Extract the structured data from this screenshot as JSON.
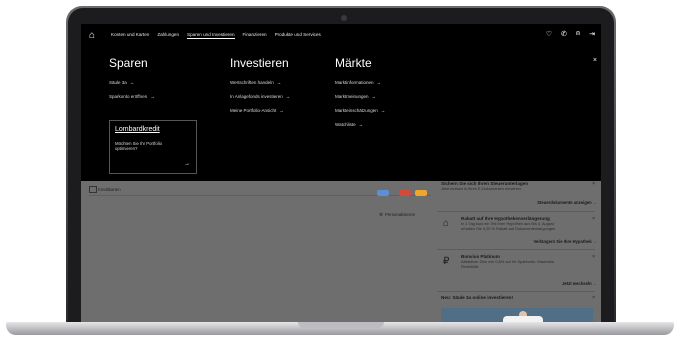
{
  "nav": {
    "home_icon": "home-icon",
    "items": [
      "Konten und Karten",
      "Zahlungen",
      "Sparen und Investieren",
      "Finanzieren",
      "Produkte und Services"
    ],
    "active_index": 2,
    "right_icons": [
      "heart-icon",
      "phone-icon",
      "user-icon",
      "logout-icon"
    ]
  },
  "mega_menu": {
    "columns": [
      {
        "heading": "Sparen",
        "links": [
          "Säule 3a",
          "Sparkonto eröffnen"
        ]
      },
      {
        "heading": "Investieren",
        "links": [
          "Wertschriften handeln",
          "In Anlagefonds investieren",
          "Meine Portfolio-Ansicht"
        ]
      },
      {
        "heading": "Märkte",
        "links": [
          "Marktinformationen",
          "Marktmeinungen",
          "Markteinschätzungen",
          "Watchliste"
        ]
      }
    ],
    "arrow": "→",
    "close": "×",
    "lombard": {
      "title": "Lombardkredit",
      "desc": "Möchten Sie Ihr Portfolio optimieren?",
      "arrow": "→"
    }
  },
  "page": {
    "row_label": "Kreditkarten",
    "personalize": "Personalisieren",
    "sidebar": [
      {
        "title": "Sichern Sie sich Ihren Steuerunterlagen",
        "desc": [
          "Jetzt einfach in Ihren E-Dokumenten einsehen."
        ],
        "cta": "Steuerdokumente anzeigen →",
        "icon": ""
      },
      {
        "title": "Rabatt auf Ihre Hypothekenverlängerung",
        "desc": [
          "In 1 Tag kurz ein Teil Ihrer Hypothek aus Bis 4. August",
          "erhalten Sie 0,20 % Rabatt auf Dokumentenlangungen"
        ],
        "cta": "Verlängern Sie Ihre Hypothek →",
        "icon": "house-percent-icon"
      },
      {
        "title": "Bonvius Platinum",
        "desc": [
          "Attraktiver Zins von 0,6% auf Ihr Sparkonto. Maximale",
          "Flexibilität"
        ],
        "cta": "Jetzt wechseln →",
        "icon": "piggy-bank-icon"
      },
      {
        "title": "Neu: Säule 3a online investieren!",
        "desc": [],
        "cta": "",
        "icon": ""
      }
    ],
    "close": "×",
    "chip_colors": [
      "#5b8fd6",
      "#d44a3a",
      "#f0a52b"
    ]
  }
}
